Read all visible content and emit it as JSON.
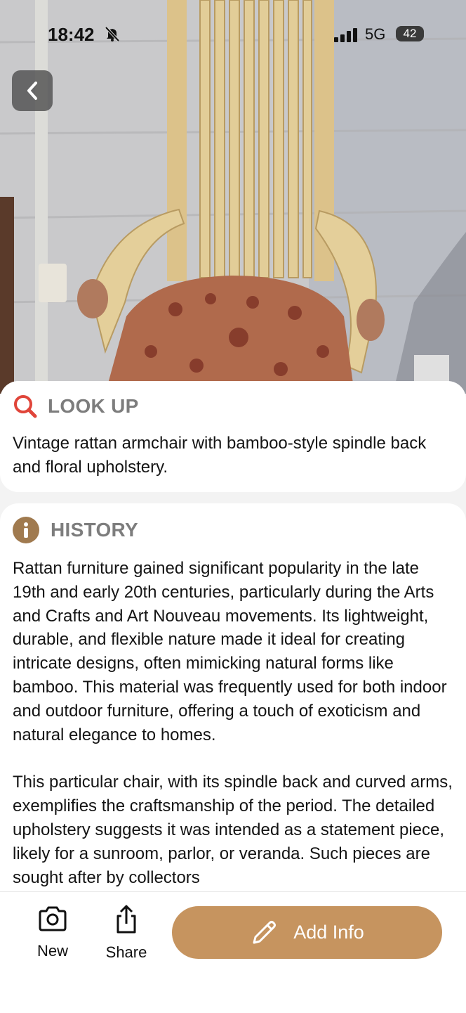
{
  "status_bar": {
    "time": "18:42",
    "network": "5G",
    "battery": "42"
  },
  "lookup": {
    "title": "LOOK UP",
    "text": "Vintage rattan armchair with bamboo-style spindle back and floral upholstery."
  },
  "history": {
    "title": "HISTORY",
    "paragraphs": [
      "Rattan furniture gained significant popularity in the late 19th and early 20th centuries, particularly during the Arts and Crafts and Art Nouveau movements. Its lightweight, durable, and flexible nature made it ideal for creating intricate designs, often mimicking natural forms like bamboo. This material was frequently used for both indoor and outdoor furniture, offering a touch of exoticism and natural elegance to homes.",
      "This particular chair, with its spindle back and curved arms, exemplifies the craftsmanship of the period. The detailed upholstery suggests it was intended as a statement piece, likely for a sunroom, parlor, or veranda. Such pieces are sought after by collectors"
    ]
  },
  "toolbar": {
    "new_label": "New",
    "share_label": "Share",
    "add_info_label": "Add Info"
  },
  "colors": {
    "accent": "#c6945f",
    "lookup_icon": "#e0453a",
    "history_icon": "#a07a4f"
  },
  "icons": [
    "bell-slash-icon",
    "back-chevron-icon",
    "search-icon",
    "info-icon",
    "camera-icon",
    "share-icon",
    "pencil-icon"
  ]
}
